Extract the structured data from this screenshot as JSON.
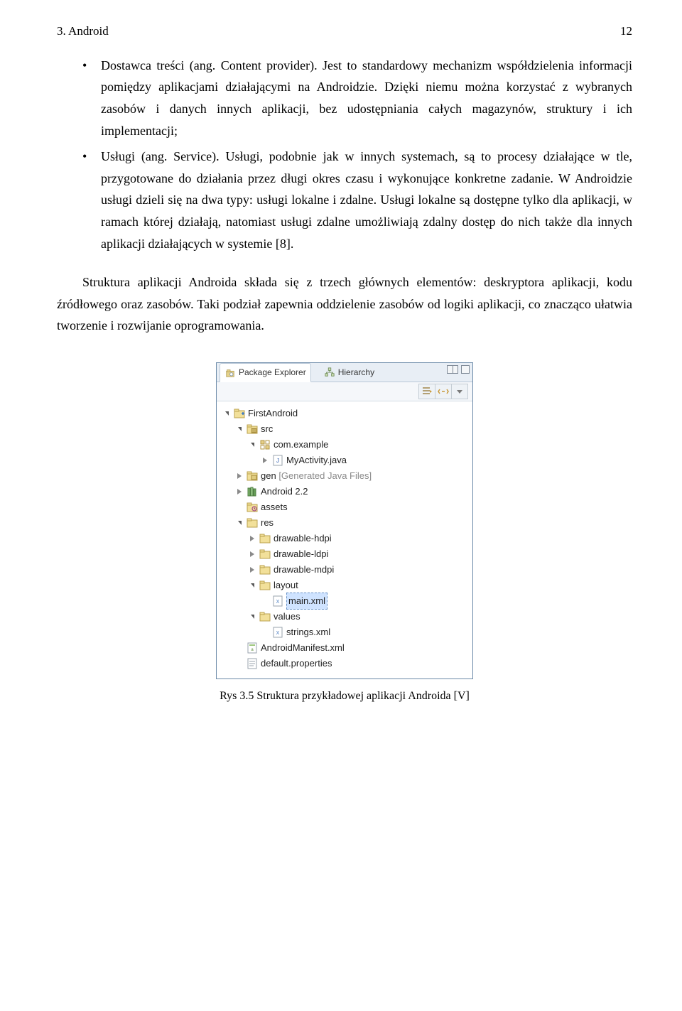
{
  "header": {
    "section": "3. Android",
    "page_number": "12"
  },
  "bullets": [
    "Dostawca treści (ang. Content provider). Jest to standardowy mechanizm współdzielenia informacji pomiędzy aplikacjami działającymi na Androidzie. Dzięki niemu można korzystać z wybranych zasobów i danych innych aplikacji, bez udostępniania całych magazynów, struktury i ich implementacji;",
    "Usługi (ang. Service). Usługi, podobnie jak w innych systemach, są to procesy działające w tle, przygotowane do działania przez długi okres czasu i wykonujące konkretne zadanie. W Androidzie usługi dzieli się na dwa typy: usługi lokalne i zdalne. Usługi lokalne są dostępne tylko dla aplikacji, w ramach której działają, natomiast usługi zdalne umożliwiają zdalny dostęp do nich także dla innych aplikacji działających w systemie [8]."
  ],
  "paragraph": "Struktura aplikacji Androida składa się z trzech głównych elementów: deskryptora aplikacji, kodu źródłowego oraz zasobów. Taki podział zapewnia oddzielenie zasobów od logiki aplikacji, co znacząco ułatwia tworzenie i rozwijanie oprogramowania.",
  "explorer": {
    "tab_active": "Package Explorer",
    "tab_other": "Hierarchy",
    "tree": {
      "project": "FirstAndroid",
      "src_folder": "src",
      "package": "com.example",
      "java_file": "MyActivity.java",
      "gen_label": "gen",
      "gen_suffix": " [Generated Java Files]",
      "android_lib": "Android 2.2",
      "assets": "assets",
      "res": "res",
      "drawable_hdpi": "drawable-hdpi",
      "drawable_ldpi": "drawable-ldpi",
      "drawable_mdpi": "drawable-mdpi",
      "layout": "layout",
      "main_xml": "main.xml",
      "values": "values",
      "strings_xml": "strings.xml",
      "manifest": "AndroidManifest.xml",
      "default_props": "default.properties"
    }
  },
  "caption": "Rys 3.5 Struktura przykładowej aplikacji Androida [V]"
}
